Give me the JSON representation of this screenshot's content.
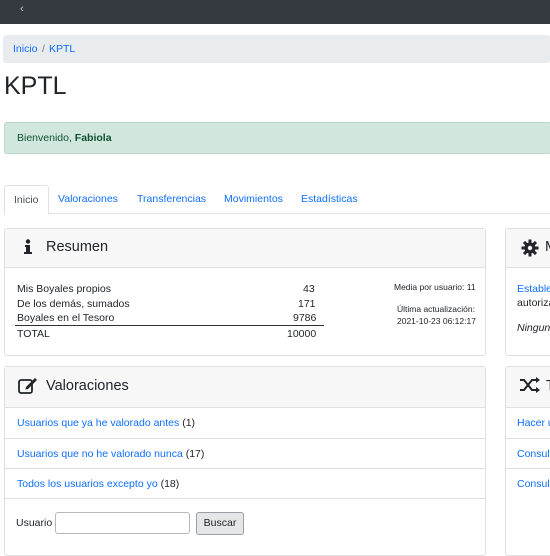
{
  "nav": {
    "back_icon": "chevron-left-icon",
    "back_glyph": "‹"
  },
  "breadcrumb": {
    "items": [
      "Inicio",
      "KPTL"
    ],
    "separator": "/"
  },
  "page_title": "KPTL",
  "alert": {
    "greeting": "Bienvenido, ",
    "user": "Fabiola"
  },
  "tabs": [
    "Inicio",
    "Valoraciones",
    "Transferencias",
    "Movimientos",
    "Estadísticas"
  ],
  "resumen": {
    "icon": "info-icon",
    "title": "Resumen",
    "rows": [
      {
        "label": "Mis Boyales propios",
        "value": "43"
      },
      {
        "label": "De los demás, sumados",
        "value": "171"
      },
      {
        "label": "Boyales en el Tesoro",
        "value": "9786"
      }
    ],
    "total": {
      "label": "TOTAL",
      "value": "10000"
    },
    "media": "Media por usuario: 11",
    "update_label": "Última actualización:",
    "update_value": "2021-10-23 06:12:17"
  },
  "right_card_1": {
    "icon": "gear-icon",
    "title_partial": "M",
    "line1": "Estable",
    "line2": "autoriza",
    "line3": "Ningun"
  },
  "valoraciones": {
    "icon": "edit-icon",
    "title": "Valoraciones",
    "items": [
      {
        "link": "Usuarios que ya he valorado antes",
        "count": " (1)"
      },
      {
        "link": "Usuarios que no he valorado nunca",
        "count": " (17)"
      },
      {
        "link": "Todos los usuarios excepto yo",
        "count": " (18)"
      }
    ],
    "search_label": "Usuario",
    "search_value": "",
    "search_button": "Buscar"
  },
  "right_card_2": {
    "icon": "shuffle-icon",
    "title_partial": "T",
    "items": [
      "Hacer u",
      "Consult",
      "Consult"
    ]
  },
  "colors": {
    "link": "#0d6efd",
    "alert_bg": "#d1e7dd",
    "topbar": "#343a40"
  }
}
